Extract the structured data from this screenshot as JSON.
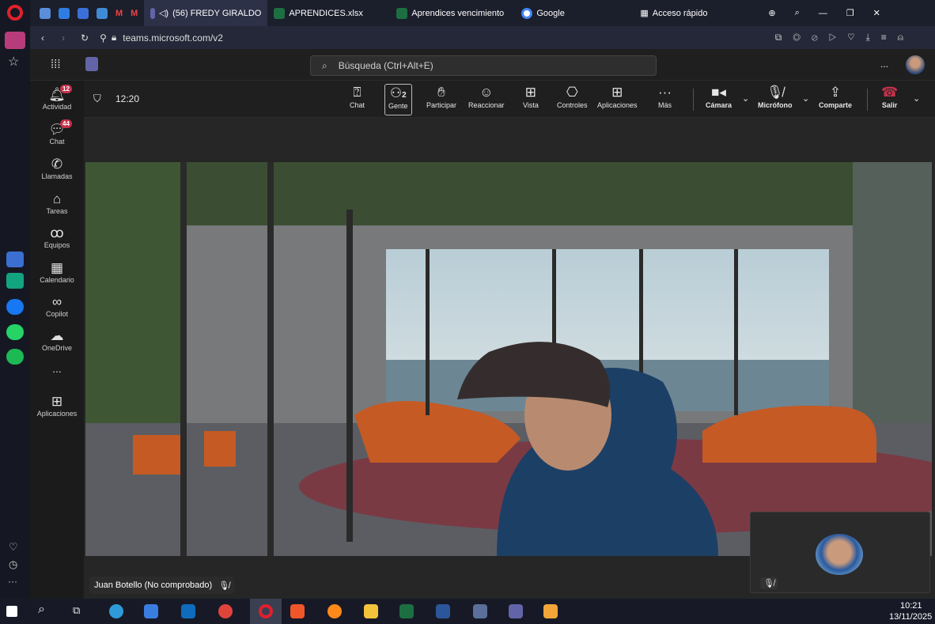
{
  "browser": {
    "tabs": [
      {
        "label": "(56) FREDY GIRALDO"
      },
      {
        "label": "APRENDICES.xlsx"
      },
      {
        "label": "Aprendices vencimiento"
      },
      {
        "label": "Google"
      },
      {
        "label": "Acceso rápido"
      }
    ],
    "url": "teams.microsoft.com/v2"
  },
  "teams": {
    "search_placeholder": "Búsqueda (Ctrl+Alt+E)",
    "more": "...",
    "nav": [
      {
        "label": "Actividad",
        "badge": "12",
        "icon": "bell-icon"
      },
      {
        "label": "Chat",
        "badge": "44",
        "icon": "chat-icon"
      },
      {
        "label": "Llamadas",
        "icon": "phone-icon"
      },
      {
        "label": "Tareas",
        "icon": "tasks-icon"
      },
      {
        "label": "Equipos",
        "icon": "teams-icon"
      },
      {
        "label": "Calendario",
        "icon": "calendar-icon"
      },
      {
        "label": "Copilot",
        "icon": "copilot-icon"
      },
      {
        "label": "OneDrive",
        "icon": "cloud-icon"
      },
      {
        "label": "...",
        "icon": "more-icon"
      },
      {
        "label": "Aplicaciones",
        "icon": "apps-icon"
      }
    ]
  },
  "meeting": {
    "timer": "12:20",
    "people_count": "2",
    "toolbar": {
      "chat": "Chat",
      "gente": "Gente",
      "participar": "Participar",
      "reaccionar": "Reaccionar",
      "vista": "Vista",
      "controles": "Controles",
      "aplicaciones": "Aplicaciones",
      "mas": "Más",
      "camara": "Cámara",
      "microfono": "Micrófono",
      "compartir": "Comparte",
      "salir": "Salir"
    },
    "participant_name": "Juan Botello (No comprobado)"
  },
  "taskbar": {
    "time": "10:21",
    "date": "13/11/2025"
  },
  "colors": {
    "accent": "#6264a7",
    "leave": "#c4314b",
    "badge": "#c4314b"
  }
}
